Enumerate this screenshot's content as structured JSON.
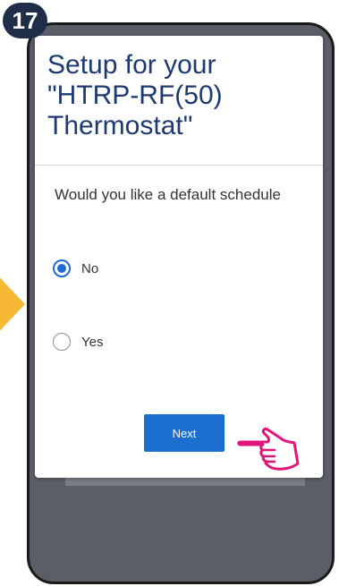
{
  "step_number": "17",
  "dialog": {
    "title": "Setup for your \"HTRP-RF(50) Thermostat\"",
    "question": "Would you like a default schedule",
    "options": [
      {
        "label": "No",
        "selected": true
      },
      {
        "label": "Yes",
        "selected": false
      }
    ],
    "next_label": "Next"
  },
  "colors": {
    "badge": "#1f2d48",
    "arrow": "#f5b734",
    "title": "#1c3a70",
    "accent": "#1f6bd6",
    "button": "#1c6fcf",
    "hand": "#e0157a"
  },
  "icons": {
    "pointer": "hand-pointer-icon",
    "step_arrow": "arrow-right-icon"
  }
}
